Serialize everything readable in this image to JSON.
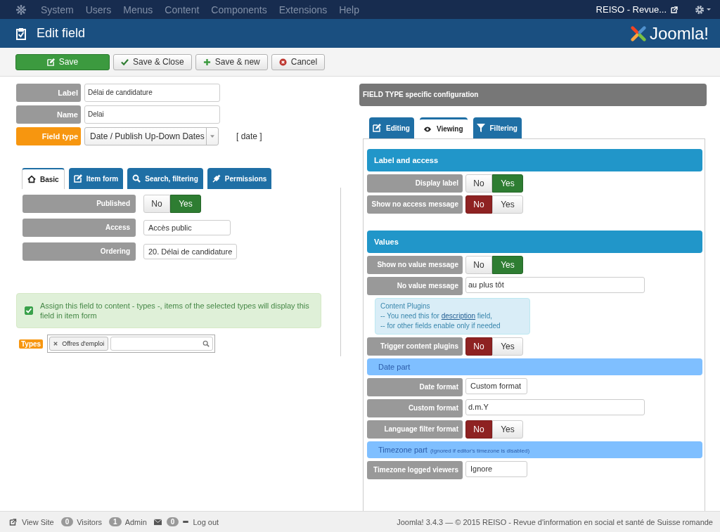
{
  "menu": {
    "items": [
      "System",
      "Users",
      "Menus",
      "Content",
      "Components",
      "Extensions",
      "Help"
    ],
    "site_link": "REISO - Revue..."
  },
  "header": {
    "title": "Edit field",
    "logo_text": "Joomla!"
  },
  "toolbar": [
    {
      "kind": "save",
      "label": "Save"
    },
    {
      "kind": "check",
      "label": "Save & Close"
    },
    {
      "kind": "plus",
      "label": "Save & new"
    },
    {
      "kind": "cancel",
      "label": "Cancel"
    }
  ],
  "main_fields": [
    {
      "kind": "text",
      "label": "Label",
      "value": "Délai de candidature",
      "required": false
    },
    {
      "kind": "text",
      "label": "Name",
      "value": "Delai",
      "required": false
    },
    {
      "kind": "select",
      "label": "Field type",
      "value": "Date / Publish Up-Down Dates",
      "required": true,
      "code": "[ date ]"
    }
  ],
  "left_tabs": [
    {
      "label": "Basic",
      "selected": true
    },
    {
      "label": "Item form",
      "selected": false
    },
    {
      "label": "Search, filtering",
      "selected": false
    },
    {
      "label": "Permissions",
      "selected": false
    }
  ],
  "basic_rows": [
    {
      "kind": "toggle",
      "label": "Published",
      "options": [
        {
          "label": "No",
          "selected": false
        },
        {
          "label": "Yes",
          "selected": true
        }
      ]
    },
    {
      "kind": "select",
      "label": "Access",
      "value": "Accès public"
    },
    {
      "kind": "select",
      "label": "Ordering",
      "value": "20. Délai de candidature"
    }
  ],
  "notice": {
    "checked": true,
    "text": "Assign this field to content - types -, items of the selected types will display this field in item form"
  },
  "types": {
    "label": "Types",
    "tags": [
      "Offres d'emploi"
    ]
  },
  "config": {
    "title": "FIELD TYPE specific configuration",
    "tabs": [
      {
        "label": "Editing",
        "selected": false
      },
      {
        "label": "Viewing",
        "selected": true
      },
      {
        "label": "Filtering",
        "selected": false
      }
    ],
    "rows": [
      {
        "kind": "section",
        "title": "Label and access"
      },
      {
        "kind": "toggle",
        "label": "Display label",
        "options": [
          {
            "label": "No",
            "selected": false
          },
          {
            "label": "Yes",
            "selected": true
          }
        ]
      },
      {
        "kind": "toggle",
        "label": "Show no access message",
        "options": [
          {
            "label": "No",
            "selected": true
          },
          {
            "label": "Yes",
            "selected": false
          }
        ]
      },
      {
        "kind": "section",
        "title": "Values"
      },
      {
        "kind": "toggle",
        "label": "Show no value message",
        "options": [
          {
            "label": "No",
            "selected": false
          },
          {
            "label": "Yes",
            "selected": true
          }
        ]
      },
      {
        "kind": "text",
        "label": "No value message",
        "value": "au plus tôt"
      },
      {
        "kind": "note",
        "title": "Content Plugins",
        "before": "-- You need this for ",
        "link": "description",
        "after": " field,",
        "line2": "-- for other fields enable only if needed"
      },
      {
        "kind": "toggle",
        "label": "Trigger content plugins",
        "options": [
          {
            "label": "No",
            "selected": true
          },
          {
            "label": "Yes",
            "selected": false
          }
        ]
      },
      {
        "kind": "subsection",
        "title": "Date part"
      },
      {
        "kind": "select",
        "label": "Date format",
        "value": "Custom format"
      },
      {
        "kind": "text",
        "label": "Custom format",
        "value": "d.m.Y"
      },
      {
        "kind": "toggle",
        "label": "Language filter format",
        "options": [
          {
            "label": "No",
            "selected": true
          },
          {
            "label": "Yes",
            "selected": false
          }
        ]
      },
      {
        "kind": "subsection",
        "title": "Timezone part",
        "note": "(Ignored if editor's timezone is disabled)"
      },
      {
        "kind": "select",
        "label": "Timezone logged viewers",
        "value": "Ignore"
      }
    ]
  },
  "status_bar": {
    "view_site": "View Site",
    "visitors_count": "0",
    "visitors": "Visitors",
    "admin_count": "1",
    "admin": "Admin",
    "messages_count": "0",
    "logout": "Log out",
    "footer": "Joomla! 3.4.3 — © 2015 REISO - Revue d'information en social et santé de Suisse romande"
  }
}
